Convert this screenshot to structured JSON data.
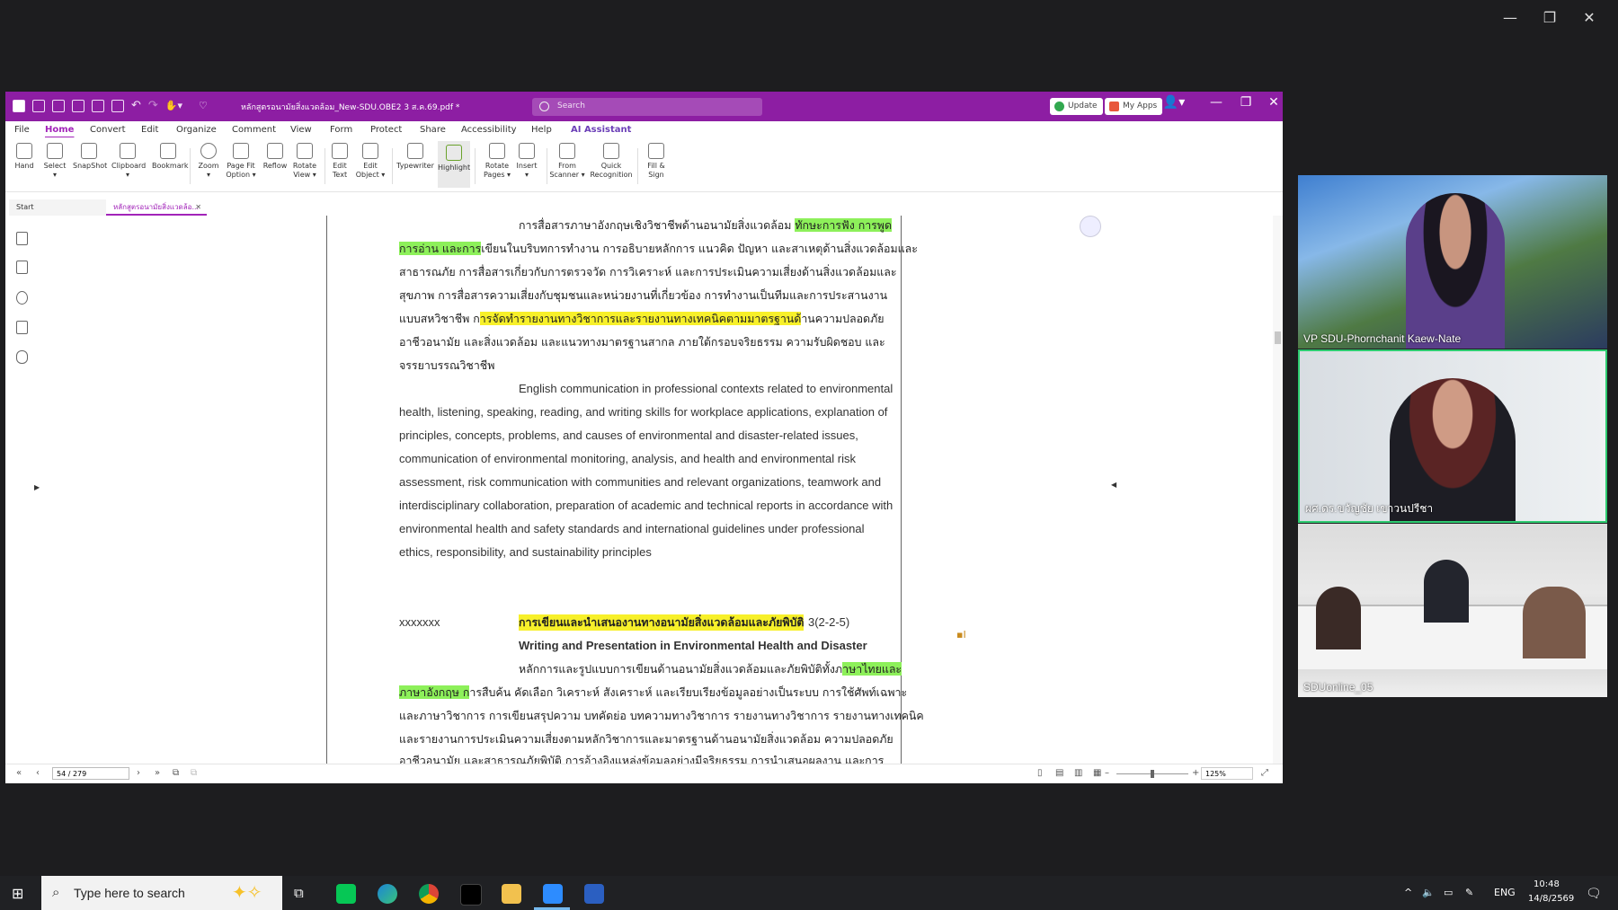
{
  "app": {
    "doc_title": "หลักสูตรอนามัยสิ่งแวดล้อม_New-SDU.OBE2 3 ส.ค.69.pdf *",
    "search_placeholder": "Search",
    "update_label": "Update",
    "myapps_label": "My Apps"
  },
  "menu": [
    "File",
    "Home",
    "Convert",
    "Edit",
    "Organize",
    "Comment",
    "View",
    "Form",
    "Protect",
    "Share",
    "Accessibility",
    "Help",
    "AI Assistant"
  ],
  "ribbon": [
    {
      "label": "Hand",
      "label2": ""
    },
    {
      "label": "Select",
      "label2": "▾"
    },
    {
      "label": "SnapShot",
      "label2": ""
    },
    {
      "label": "Clipboard",
      "label2": "▾"
    },
    {
      "label": "Bookmark",
      "label2": ""
    },
    {
      "label": "Zoom",
      "label2": "▾"
    },
    {
      "label": "Page Fit",
      "label2": "Option ▾"
    },
    {
      "label": "Reflow",
      "label2": ""
    },
    {
      "label": "Rotate",
      "label2": "View ▾"
    },
    {
      "label": "Edit",
      "label2": "Text"
    },
    {
      "label": "Edit",
      "label2": "Object ▾"
    },
    {
      "label": "Typewriter",
      "label2": ""
    },
    {
      "label": "Highlight",
      "label2": ""
    },
    {
      "label": "Rotate",
      "label2": "Pages ▾"
    },
    {
      "label": "Insert",
      "label2": "▾"
    },
    {
      "label": "From",
      "label2": "Scanner ▾"
    },
    {
      "label": "Quick",
      "label2": "Recognition"
    },
    {
      "label": "Fill &",
      "label2": "Sign"
    }
  ],
  "tabs": {
    "start": "Start",
    "doc": "หลักสูตรอนามัยสิ่งแวดล้อ..."
  },
  "page": {
    "th1_indent": "การสื่อสารภาษาอังกฤษเชิงวิชาชีพด้านอนามัยสิ่งแวดล้อม ",
    "th1_hl": "ทักษะการฟัง การพูด",
    "th2_hl": "การอ่าน และการ",
    "th2_rest": "เขียนในบริบทการทำงาน การอธิบายหลักการ แนวคิด ปัญหา และสาเหตุด้านสิ่งแวดล้อมและ",
    "th3": "สาธารณภัย การสื่อสารเกี่ยวกับการตรวจวัด การวิเคราะห์ และการประเมินความเสี่ยงด้านสิ่งแวดล้อมและ",
    "th4": "สุขภาพ การสื่อสารความเสี่ยงกับชุมชนและหน่วยงานที่เกี่ยวข้อง การทำงานเป็นทีมและการประสานงาน",
    "th5_a": "แบบสหวิชาชีพ ก",
    "th5_hl": "ารจัดทำรายงานทางวิชาการและรายงานทางเทคนิคตามมาตรฐานด้",
    "th5_b": "านความปลอดภัย",
    "th6": "อาชีวอนามัย และสิ่งแวดล้อม และแนวทางมาตรฐานสากล ภายใต้กรอบจริยธรรม ความรับผิดชอบ และ",
    "th7": "จรรยาบรรณวิชาชีพ",
    "en1": "English communication in professional contexts related to environmental",
    "en2": "health, listening, speaking, reading, and writing skills for workplace applications, explanation of",
    "en3": "principles, concepts, problems, and causes of environmental and disaster-related issues,",
    "en4": "communication of environmental monitoring, analysis, and health and environmental risk",
    "en5": "assessment, risk communication with communities and relevant organizations, teamwork and",
    "en6": "interdisciplinary collaboration, preparation of academic and technical reports in accordance with",
    "en7": "environmental health and safety standards and international guidelines under professional",
    "en8": "ethics, responsibility, and sustainability principles",
    "course_code": "xxxxxxx",
    "course_th": "การเขียนและนำเสนองานทางอนามัยสิ่งแวดล้อมและภัยพิบัติ",
    "credits": "3(2-2-5)",
    "course_en": "Writing and Presentation in Environmental Health and Disaster",
    "c1_a": "หลักการและรูปแบบการเขียนด้านอนามัยสิ่งแวดล้อมและภัยพิบัติทั้งภ",
    "c1_hl": "าษาไทยและ",
    "c2_hl": "ภาษาอังกฤษ ก",
    "c2_rest": "ารสืบค้น คัดเลือก วิเคราะห์ สังเคราะห์ และเรียบเรียงข้อมูลอย่างเป็นระบบ การใช้ศัพท์เฉพาะ",
    "c3": "และภาษาวิชาการ การเขียนสรุปความ บทคัดย่อ บทความทางวิชาการ รายงานทางวิชาการ รายงานทางเทคนิค",
    "c4": "และรายงานการประเมินความเสี่ยงตามหลักวิชาการและมาตรฐานด้านอนามัยสิ่งแวดล้อม ความปลอดภัย",
    "c5": "อาชีวอนามัย และสาธารณภัยพิบัติ การอ้างอิงแหล่งข้อมูลอย่างมีจริยธรรม การนำเสนอผลงาน และการ"
  },
  "status": {
    "page": "54 / 279",
    "zoom": "125%"
  },
  "participants": [
    "VP SDU-Phornchanit Kaew-Nate",
    "ผศ.ดร.ขวัญชัย เขาวนปรีชา",
    "SDUonline_05"
  ],
  "taskbar": {
    "search_placeholder": "Type here to search",
    "lang": "ENG",
    "time": "10:48",
    "date": "14/8/2569"
  },
  "colors": {
    "title_bar": "#8d1ea3",
    "highlight_green": "#8df05a",
    "highlight_yellow": "#f7f02a",
    "active_speaker_border": "#2ecc71"
  }
}
